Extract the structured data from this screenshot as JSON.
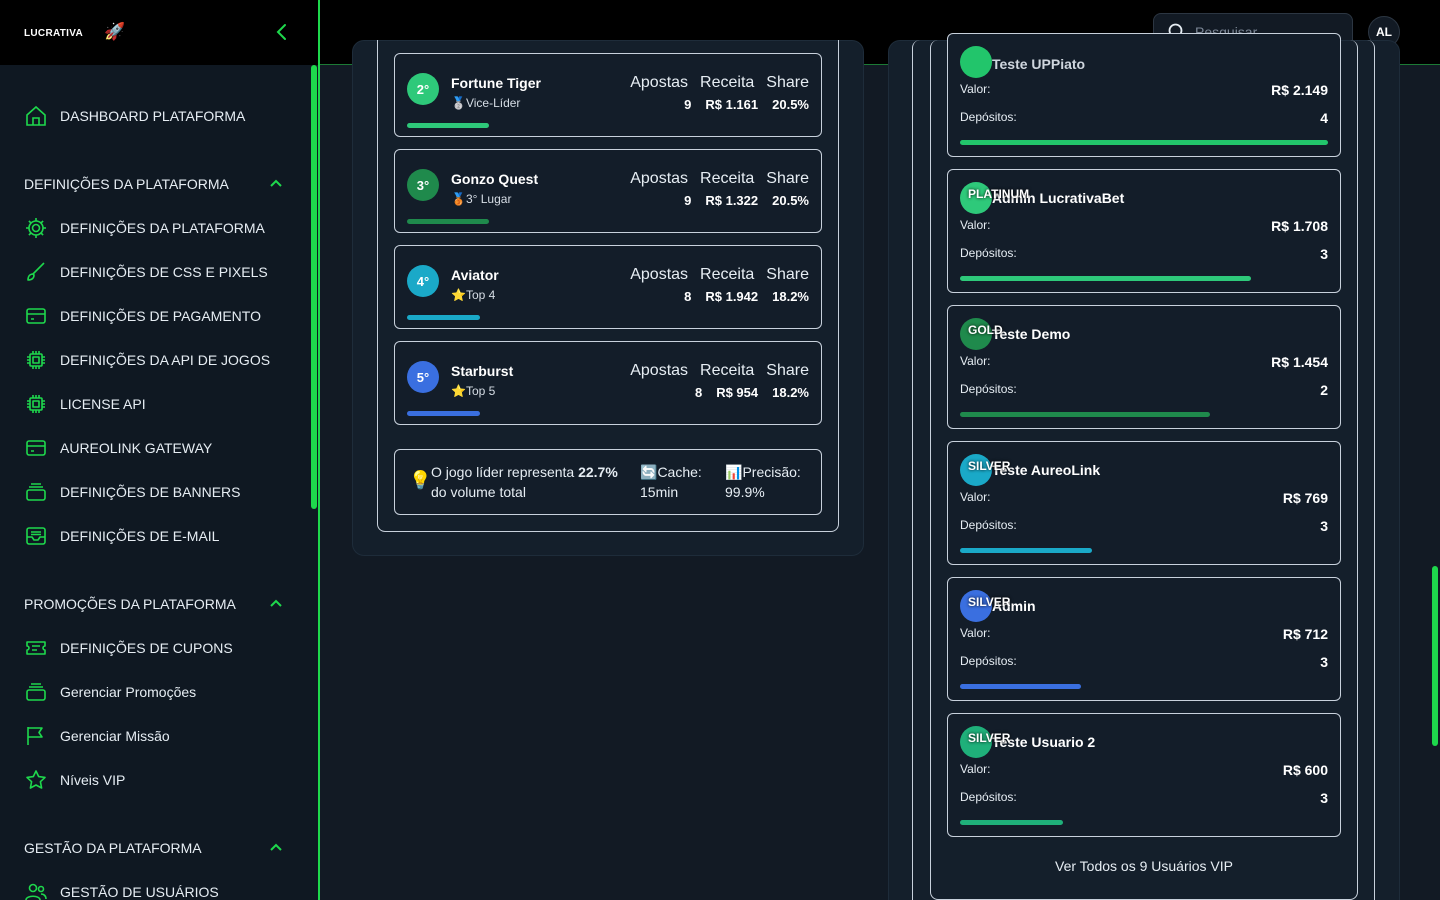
{
  "brand": {
    "logo_text": "LUCRATIVA",
    "logo_emoji": "🚀"
  },
  "colors": {
    "accent": "#1ed84c",
    "bg": "#121a24",
    "sidebar": "#0f1822"
  },
  "topbar": {
    "search_placeholder": "Pesquisar",
    "avatar_initials": "AL"
  },
  "sidebar": {
    "dashboard": "DASHBOARD PLATAFORMA",
    "section_definicoes": "DEFINIÇÕES DA PLATAFORMA",
    "definicoes_items": [
      {
        "label": "DEFINIÇÕES DA PLATAFORMA",
        "icon": "gear-icon"
      },
      {
        "label": "DEFINIÇÕES DE CSS E PIXELS",
        "icon": "brush-icon"
      },
      {
        "label": "DEFINIÇÕES DE PAGAMENTO",
        "icon": "card-icon"
      },
      {
        "label": "DEFINIÇÕES DA API DE JOGOS",
        "icon": "chip-icon"
      },
      {
        "label": "LICENSE API",
        "icon": "chip-icon"
      },
      {
        "label": "AUREOLINK GATEWAY",
        "icon": "card-icon"
      },
      {
        "label": "DEFINIÇÕES DE BANNERS",
        "icon": "stack-icon"
      },
      {
        "label": "DEFINIÇÕES DE E-MAIL",
        "icon": "inbox-icon"
      }
    ],
    "section_promocoes": "PROMOÇÕES DA PLATAFORMA",
    "promocoes_items": [
      {
        "label": "DEFINIÇÕES DE CUPONS",
        "icon": "ticket-icon"
      },
      {
        "label": "Gerenciar Promoções",
        "icon": "stack-icon"
      },
      {
        "label": "Gerenciar Missão",
        "icon": "flag-icon"
      },
      {
        "label": "Níveis VIP",
        "icon": "star-icon"
      }
    ],
    "section_gestao": "GESTÃO DA PLATAFORMA",
    "gestao_items": [
      {
        "label": "GESTÃO DE USUÁRIOS",
        "icon": "users-icon"
      }
    ]
  },
  "games": {
    "headers": {
      "apostas": "Apostas",
      "receita": "Receita",
      "share": "Share"
    },
    "items": [
      {
        "rank": "2°",
        "name": "Fortune Tiger",
        "badge": "🥈",
        "sub": "Vice-Líder",
        "apostas": "9",
        "receita": "R$ 1.161",
        "share": "20.5%",
        "share_value": 20.5,
        "color": "#2ec97a"
      },
      {
        "rank": "3°",
        "name": "Gonzo Quest",
        "badge": "🥉",
        "sub": "3° Lugar",
        "apostas": "9",
        "receita": "R$ 1.322",
        "share": "20.5%",
        "share_value": 20.5,
        "color": "#1f8a4c"
      },
      {
        "rank": "4°",
        "name": "Aviator",
        "badge": "⭐",
        "sub": "Top 4",
        "apostas": "8",
        "receita": "R$ 1.942",
        "share": "18.2%",
        "share_value": 18.2,
        "color": "#1aa9c8"
      },
      {
        "rank": "5°",
        "name": "Starburst",
        "badge": "⭐",
        "sub": "Top 5",
        "apostas": "8",
        "receita": "R$ 954",
        "share": "18.2%",
        "share_value": 18.2,
        "color": "#3a6fe0"
      }
    ],
    "info": {
      "bulb": "💡",
      "lead_prefix": "O jogo líder representa ",
      "lead_value": "22.7%",
      "lead_suffix": "do volume total",
      "cache_icon": "🔄",
      "cache_label": "Cache:",
      "cache_value": "15min",
      "precision_icon": "📊",
      "precision_label": "Precisão:",
      "precision_value": "99.9%"
    }
  },
  "vip": {
    "valor_label": "Valor:",
    "depositos_label": "Depósitos:",
    "partial_card": {
      "valor": "R$ 2.149",
      "depositos": "4",
      "partial_name": "Teste UPPiato",
      "fill": 1.0,
      "color": "#22c56b"
    },
    "users": [
      {
        "tier": "PLATINUM",
        "name": "Admin LucrativaBet",
        "valor": "R$ 1.708",
        "depositos": "3",
        "fill": 0.79,
        "color": "#2ec97a"
      },
      {
        "tier": "GOLD",
        "name": "Teste Demo",
        "valor": "R$ 1.454",
        "depositos": "2",
        "fill": 0.68,
        "color": "#1f8a4c"
      },
      {
        "tier": "SILVER",
        "name": "Teste AureoLink",
        "valor": "R$ 769",
        "depositos": "3",
        "fill": 0.36,
        "color": "#1aa9c8"
      },
      {
        "tier": "SILVER",
        "name": "Admin",
        "valor": "R$ 712",
        "depositos": "3",
        "fill": 0.33,
        "color": "#3a6fe0"
      },
      {
        "tier": "SILVER",
        "name": "Teste Usuario 2",
        "valor": "R$ 600",
        "depositos": "3",
        "fill": 0.28,
        "color": "#1fb07a"
      }
    ],
    "view_all": "Ver Todos os 9 Usuários VIP"
  }
}
